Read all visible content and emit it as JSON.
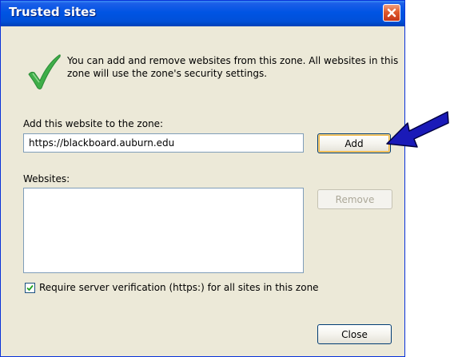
{
  "window": {
    "title": "Trusted sites"
  },
  "message": "You can add and remove websites from this zone. All websites in this zone will use the zone's security settings.",
  "add_section": {
    "label": "Add this website to the zone:",
    "url_value": "https://blackboard.auburn.edu",
    "add_button": "Add"
  },
  "websites_section": {
    "label": "Websites:",
    "remove_button": "Remove",
    "items": []
  },
  "verification": {
    "checked": true,
    "label": "Require server verification (https:) for all sites in this zone"
  },
  "close_button": "Close",
  "icons": {
    "title_close": "close-icon",
    "info": "checkmark-icon",
    "annotation": "arrow-icon",
    "checkbox_mark": "checkmark-icon"
  },
  "colors": {
    "titlebar": "#0054e3",
    "dialog_background": "#ece9d8",
    "close_button": "#e05a2c",
    "check_green": "#3fae49",
    "annotation_arrow": "#1a1ab8"
  }
}
